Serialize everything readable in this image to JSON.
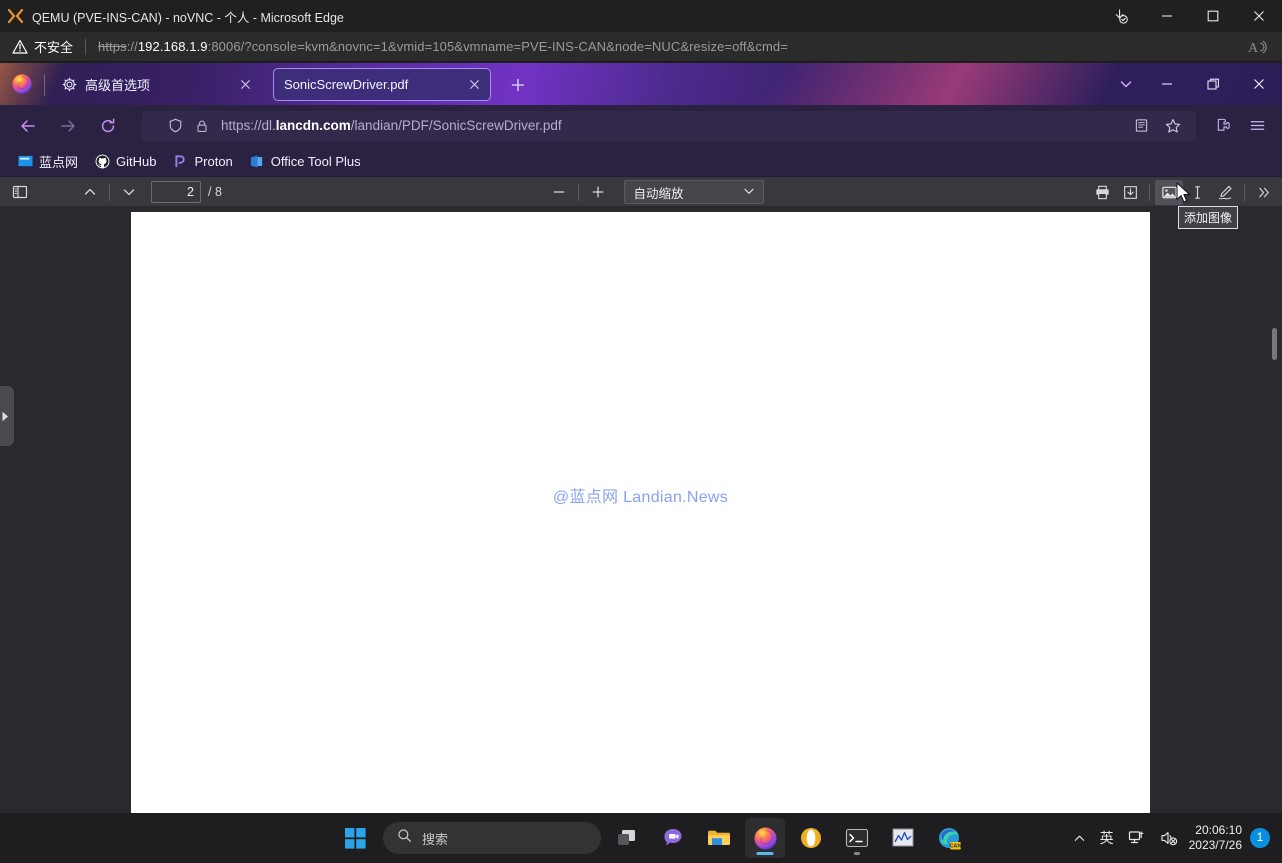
{
  "edge_window": {
    "title": "QEMU (PVE-INS-CAN) - noVNC - 个人 - Microsoft Edge",
    "icon": "novnc-icon",
    "security_label": "不安全",
    "security_icon": "warning-triangle-icon",
    "url": {
      "scheme": "https",
      "separator": "://",
      "host": "192.168.1.9",
      "rest": ":8006/?console=kvm&novnc=1&vmid=105&vmname=PVE-INS-CAN&node=NUC&resize=off&cmd="
    },
    "read_aloud_icon": "read-aloud-icon",
    "controls": {
      "downloads_icon": "download-complete-icon",
      "minimize_icon": "minimize-icon",
      "maximize_icon": "maximize-icon",
      "close_icon": "close-icon"
    }
  },
  "firefox": {
    "logo_icon": "firefox-logo-icon",
    "tabs": [
      {
        "label": "高级首选项",
        "favicon": "gear-icon",
        "active": false,
        "close_icon": "close-icon"
      },
      {
        "label": "SonicScrewDriver.pdf",
        "favicon": "",
        "active": true,
        "close_icon": "close-icon"
      }
    ],
    "new_tab_icon": "plus-icon",
    "tab_list_icon": "chevron-down-icon",
    "controls": {
      "minimize_icon": "minimize-icon",
      "restore_icon": "restore-icon",
      "close_icon": "close-icon"
    },
    "nav": {
      "back_icon": "arrow-left-icon",
      "forward_icon": "arrow-right-icon",
      "reload_icon": "reload-icon",
      "shield_icon": "shield-icon",
      "lock_icon": "lock-icon",
      "reader_icon": "reader-view-icon",
      "bookmark_icon": "star-icon",
      "extensions_icon": "extensions-puzzle-icon",
      "menu_icon": "hamburger-menu-icon"
    },
    "url": {
      "prefix": "https://dl.",
      "domain": "lancdn.com",
      "path": "/landian/PDF/SonicScrewDriver.pdf"
    },
    "bookmarks": [
      {
        "label": "蓝点网",
        "icon": "landian-icon"
      },
      {
        "label": "GitHub",
        "icon": "github-icon"
      },
      {
        "label": "Proton",
        "icon": "proton-icon"
      },
      {
        "label": "Office Tool Plus",
        "icon": "office-tool-plus-icon"
      }
    ]
  },
  "pdf_viewer": {
    "sidebar_toggle_icon": "sidebar-toggle-icon",
    "prev_page_icon": "chevron-up-icon",
    "next_page_icon": "chevron-down-icon",
    "page_number": "2",
    "page_total": "/ 8",
    "zoom_out_icon": "minus-icon",
    "zoom_in_icon": "plus-icon",
    "zoom_level": "自动缩放",
    "zoom_caret_icon": "chevron-down-icon",
    "tools": [
      {
        "name": "print-button",
        "icon": "printer-icon",
        "highlighted": false
      },
      {
        "name": "save-button",
        "icon": "download-icon",
        "highlighted": false
      },
      {
        "name": "add-image-button",
        "icon": "image-icon",
        "highlighted": true
      },
      {
        "name": "add-text-button",
        "icon": "text-cursor-icon",
        "highlighted": false
      },
      {
        "name": "draw-button",
        "icon": "pen-icon",
        "highlighted": false
      },
      {
        "name": "more-tools-button",
        "icon": "double-chevron-right-icon",
        "highlighted": false
      }
    ],
    "tooltip": "添加图像",
    "page_watermark": "@蓝点网 Landian.News",
    "sidebar_handle_icon": "expand-sidebar-arrow-icon"
  },
  "taskbar": {
    "start_icon": "windows-start-icon",
    "search_icon": "search-icon",
    "search_placeholder": "搜索",
    "apps": [
      {
        "name": "task-view",
        "icon": "task-view-icon",
        "active": false
      },
      {
        "name": "chat",
        "icon": "chat-icon",
        "active": false
      },
      {
        "name": "file-explorer",
        "icon": "folder-icon",
        "active": false
      },
      {
        "name": "firefox",
        "icon": "firefox-icon",
        "active": true
      },
      {
        "name": "opera",
        "icon": "opera-icon",
        "active": false
      },
      {
        "name": "terminal",
        "icon": "terminal-icon",
        "active": false
      },
      {
        "name": "monitor",
        "icon": "chart-monitor-icon",
        "active": false
      },
      {
        "name": "edge-canary",
        "icon": "edge-canary-icon",
        "active": false
      }
    ],
    "tray": {
      "overflow_icon": "chevron-up-icon",
      "ime_label": "英",
      "network_icon": "network-disconnected-icon",
      "volume_icon": "volume-muted-icon",
      "time": "20:06:10",
      "date": "2023/7/26",
      "notification_count": "1"
    }
  }
}
